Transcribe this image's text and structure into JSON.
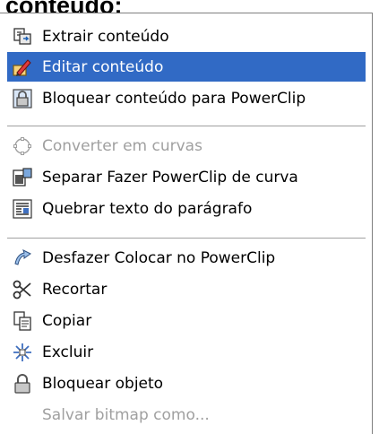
{
  "heading": "conteúdo:",
  "menu": {
    "items": [
      {
        "label": "Extrair conteúdo",
        "icon": "extract-content-icon",
        "state": "normal"
      },
      {
        "label": "Editar conteúdo",
        "icon": "edit-content-icon",
        "state": "highlighted"
      },
      {
        "label": "Bloquear conteúdo para PowerClip",
        "icon": "lock-content-icon",
        "state": "normal"
      },
      {
        "label": "Converter em curvas",
        "icon": "convert-to-curves-icon",
        "state": "disabled"
      },
      {
        "label": "Separar Fazer PowerClip de curva",
        "icon": "separate-powerclip-icon",
        "state": "normal"
      },
      {
        "label": "Quebrar texto do parágrafo",
        "icon": "paragraph-wrap-icon",
        "state": "normal"
      },
      {
        "label": "Desfazer Colocar no PowerClip",
        "icon": "undo-icon",
        "state": "normal"
      },
      {
        "label": "Recortar",
        "icon": "scissors-icon",
        "state": "normal"
      },
      {
        "label": "Copiar",
        "icon": "copy-icon",
        "state": "normal"
      },
      {
        "label": "Excluir",
        "icon": "delete-icon",
        "state": "normal"
      },
      {
        "label": "Bloquear objeto",
        "icon": "lock-icon",
        "state": "normal"
      },
      {
        "label": "Salvar bitmap como...",
        "icon": "",
        "state": "disabled"
      }
    ]
  },
  "colors": {
    "highlight_bg": "#316ac5",
    "highlight_text": "#ffffff",
    "disabled_text": "#a0a0a0",
    "border": "#7f7f7f"
  }
}
